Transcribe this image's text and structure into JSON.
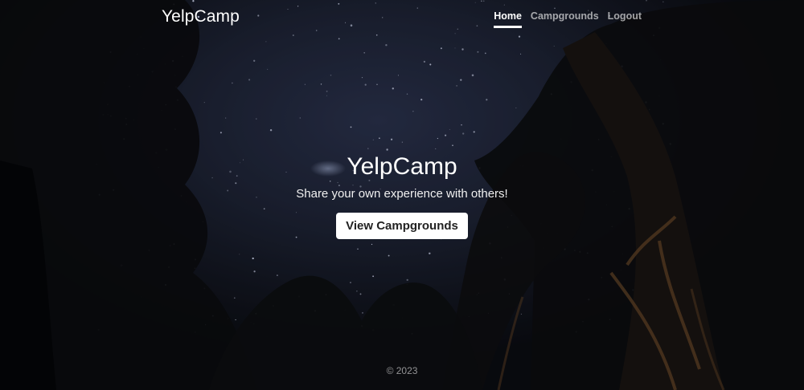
{
  "navbar": {
    "brand": "YelpCamp",
    "links": [
      {
        "label": "Home",
        "active": true
      },
      {
        "label": "Campgrounds",
        "active": false
      },
      {
        "label": "Logout",
        "active": false
      }
    ]
  },
  "hero": {
    "title": "YelpCamp",
    "subtitle": "Share your own experience with others!",
    "button_label": "View Campgrounds"
  },
  "footer": {
    "copyright": "© 2023"
  }
}
